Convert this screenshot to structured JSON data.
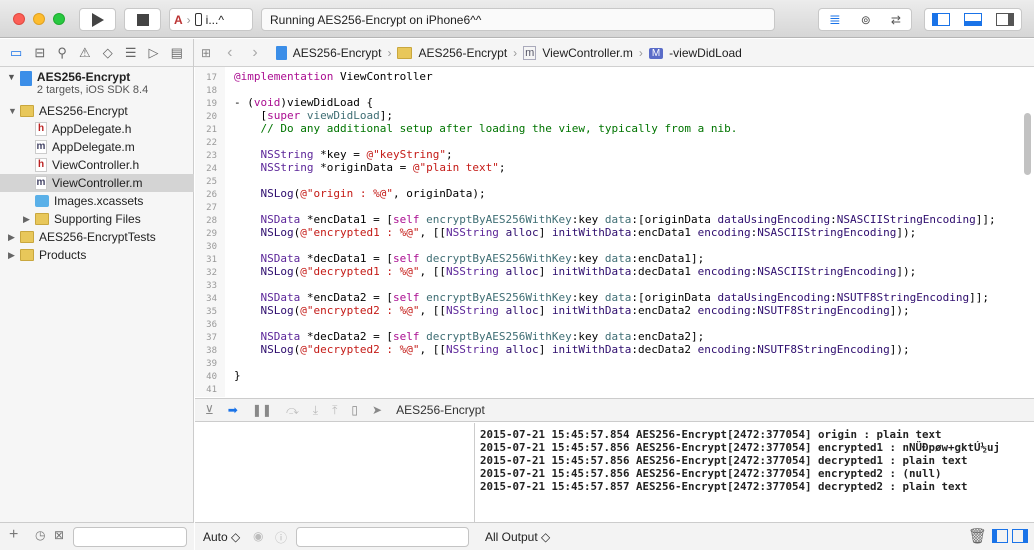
{
  "toolbar": {
    "scheme_device": "i...^",
    "status": "Running AES256-Encrypt on iPhone6^^"
  },
  "navigator_icons": [
    "folder-icon",
    "hierarchy-icon",
    "search-icon",
    "warning-icon",
    "test-diamond-icon",
    "debug-list-icon",
    "breakpoint-icon",
    "report-icon"
  ],
  "jumpbar": [
    "AES256-Encrypt",
    "AES256-Encrypt",
    "ViewController.m",
    "-viewDidLoad"
  ],
  "navigator": {
    "project": {
      "name": "AES256-Encrypt",
      "subtitle": "2 targets, iOS SDK 8.4"
    },
    "items": [
      {
        "label": "AES256-Encrypt",
        "type": "folder",
        "level": 1,
        "disclosure": "open"
      },
      {
        "label": "AppDelegate.h",
        "type": "h",
        "level": 2
      },
      {
        "label": "AppDelegate.m",
        "type": "m",
        "level": 2
      },
      {
        "label": "ViewController.h",
        "type": "h",
        "level": 2
      },
      {
        "label": "ViewController.m",
        "type": "m",
        "level": 2,
        "selected": true
      },
      {
        "label": "Images.xcassets",
        "type": "assets",
        "level": 2
      },
      {
        "label": "Supporting Files",
        "type": "folder",
        "level": 2,
        "disclosure": "closed"
      },
      {
        "label": "AES256-EncryptTests",
        "type": "folder",
        "level": 1,
        "disclosure": "closed"
      },
      {
        "label": "Products",
        "type": "folder",
        "level": 1,
        "disclosure": "closed"
      }
    ]
  },
  "code": [
    {
      "n": "17",
      "seg": [
        [
          "k",
          "@implementation"
        ],
        [
          "p",
          " ViewController"
        ]
      ]
    },
    {
      "n": "18",
      "seg": []
    },
    {
      "n": "19",
      "seg": [
        [
          "p",
          "- ("
        ],
        [
          "k",
          "void"
        ],
        [
          "p",
          ")viewDidLoad {"
        ]
      ]
    },
    {
      "n": "20",
      "seg": [
        [
          "p",
          "    ["
        ],
        [
          "k",
          "super"
        ],
        [
          "p",
          " "
        ],
        [
          "mm",
          "viewDidLoad"
        ],
        [
          "p",
          "];"
        ]
      ]
    },
    {
      "n": "21",
      "seg": [
        [
          "c",
          "    // Do any additional setup after loading the view, typically from a nib."
        ]
      ]
    },
    {
      "n": "22",
      "seg": []
    },
    {
      "n": "23",
      "seg": [
        [
          "t",
          "    NSString"
        ],
        [
          "p",
          " *key = "
        ],
        [
          "s",
          "@\"keyString\""
        ],
        [
          "p",
          ";"
        ]
      ]
    },
    {
      "n": "24",
      "seg": [
        [
          "t",
          "    NSString"
        ],
        [
          "p",
          " *originData = "
        ],
        [
          "s",
          "@\"plain text\""
        ],
        [
          "p",
          ";"
        ]
      ]
    },
    {
      "n": "25",
      "seg": []
    },
    {
      "n": "26",
      "seg": [
        [
          "m",
          "    NSLog"
        ],
        [
          "p",
          "("
        ],
        [
          "s",
          "@\"origin : %@\""
        ],
        [
          "p",
          ", originData);"
        ]
      ]
    },
    {
      "n": "27",
      "seg": []
    },
    {
      "n": "28",
      "seg": [
        [
          "t",
          "    NSData"
        ],
        [
          "p",
          " *encData1 = ["
        ],
        [
          "k",
          "self"
        ],
        [
          "p",
          " "
        ],
        [
          "mm",
          "encryptByAES256WithKey"
        ],
        [
          "p",
          ":key "
        ],
        [
          "mm",
          "data"
        ],
        [
          "p",
          ":[originData "
        ],
        [
          "m",
          "dataUsingEncoding"
        ],
        [
          "p",
          ":"
        ],
        [
          "m",
          "NSASCIIStringEncoding"
        ],
        [
          "p",
          "]];"
        ]
      ]
    },
    {
      "n": "29",
      "seg": [
        [
          "m",
          "    NSLog"
        ],
        [
          "p",
          "("
        ],
        [
          "s",
          "@\"encrypted1 : %@\""
        ],
        [
          "p",
          ", [["
        ],
        [
          "t",
          "NSString"
        ],
        [
          "p",
          " "
        ],
        [
          "m",
          "alloc"
        ],
        [
          "p",
          "] "
        ],
        [
          "m",
          "initWithData"
        ],
        [
          "p",
          ":encData1 "
        ],
        [
          "m",
          "encoding"
        ],
        [
          "p",
          ":"
        ],
        [
          "m",
          "NSASCIIStringEncoding"
        ],
        [
          "p",
          "]);"
        ]
      ]
    },
    {
      "n": "30",
      "seg": []
    },
    {
      "n": "31",
      "seg": [
        [
          "t",
          "    NSData"
        ],
        [
          "p",
          " *decData1 = ["
        ],
        [
          "k",
          "self"
        ],
        [
          "p",
          " "
        ],
        [
          "mm",
          "decryptByAES256WithKey"
        ],
        [
          "p",
          ":key "
        ],
        [
          "mm",
          "data"
        ],
        [
          "p",
          ":encData1];"
        ]
      ]
    },
    {
      "n": "32",
      "seg": [
        [
          "m",
          "    NSLog"
        ],
        [
          "p",
          "("
        ],
        [
          "s",
          "@\"decrypted1 : %@\""
        ],
        [
          "p",
          ", [["
        ],
        [
          "t",
          "NSString"
        ],
        [
          "p",
          " "
        ],
        [
          "m",
          "alloc"
        ],
        [
          "p",
          "] "
        ],
        [
          "m",
          "initWithData"
        ],
        [
          "p",
          ":decData1 "
        ],
        [
          "m",
          "encoding"
        ],
        [
          "p",
          ":"
        ],
        [
          "m",
          "NSASCIIStringEncoding"
        ],
        [
          "p",
          "]);"
        ]
      ]
    },
    {
      "n": "33",
      "seg": []
    },
    {
      "n": "34",
      "seg": [
        [
          "t",
          "    NSData"
        ],
        [
          "p",
          " *encData2 = ["
        ],
        [
          "k",
          "self"
        ],
        [
          "p",
          " "
        ],
        [
          "mm",
          "encryptByAES256WithKey"
        ],
        [
          "p",
          ":key "
        ],
        [
          "mm",
          "data"
        ],
        [
          "p",
          ":[originData "
        ],
        [
          "m",
          "dataUsingEncoding"
        ],
        [
          "p",
          ":"
        ],
        [
          "m",
          "NSUTF8StringEncoding"
        ],
        [
          "p",
          "]];"
        ]
      ]
    },
    {
      "n": "35",
      "seg": [
        [
          "m",
          "    NSLog"
        ],
        [
          "p",
          "("
        ],
        [
          "s",
          "@\"encrypted2 : %@\""
        ],
        [
          "p",
          ", [["
        ],
        [
          "t",
          "NSString"
        ],
        [
          "p",
          " "
        ],
        [
          "m",
          "alloc"
        ],
        [
          "p",
          "] "
        ],
        [
          "m",
          "initWithData"
        ],
        [
          "p",
          ":encData2 "
        ],
        [
          "m",
          "encoding"
        ],
        [
          "p",
          ":"
        ],
        [
          "m",
          "NSUTF8StringEncoding"
        ],
        [
          "p",
          "]);"
        ]
      ]
    },
    {
      "n": "36",
      "seg": []
    },
    {
      "n": "37",
      "seg": [
        [
          "t",
          "    NSData"
        ],
        [
          "p",
          " *decData2 = ["
        ],
        [
          "k",
          "self"
        ],
        [
          "p",
          " "
        ],
        [
          "mm",
          "decryptByAES256WithKey"
        ],
        [
          "p",
          ":key "
        ],
        [
          "mm",
          "data"
        ],
        [
          "p",
          ":encData2];"
        ]
      ]
    },
    {
      "n": "38",
      "seg": [
        [
          "m",
          "    NSLog"
        ],
        [
          "p",
          "("
        ],
        [
          "s",
          "@\"decrypted2 : %@\""
        ],
        [
          "p",
          ", [["
        ],
        [
          "t",
          "NSString"
        ],
        [
          "p",
          " "
        ],
        [
          "m",
          "alloc"
        ],
        [
          "p",
          "] "
        ],
        [
          "m",
          "initWithData"
        ],
        [
          "p",
          ":decData2 "
        ],
        [
          "m",
          "encoding"
        ],
        [
          "p",
          ":"
        ],
        [
          "m",
          "NSUTF8StringEncoding"
        ],
        [
          "p",
          "]);"
        ]
      ]
    },
    {
      "n": "39",
      "seg": []
    },
    {
      "n": "40",
      "seg": [
        [
          "p",
          "}"
        ]
      ]
    },
    {
      "n": "41",
      "seg": []
    }
  ],
  "debugbar": {
    "target": "AES256-Encrypt"
  },
  "console": [
    "2015-07-21 15:45:57.854 AES256-Encrypt[2472:377054] origin : plain text",
    "2015-07-21 15:45:57.856 AES256-Encrypt[2472:377054] encrypted1 : nNÜÐpøw+gktÚ½uj",
    "2015-07-21 15:45:57.856 AES256-Encrypt[2472:377054] decrypted1 : plain text",
    "2015-07-21 15:45:57.856 AES256-Encrypt[2472:377054] encrypted2 : (null)",
    "2015-07-21 15:45:57.857 AES256-Encrypt[2472:377054] decrypted2 : plain text"
  ],
  "bottom": {
    "vars_scope": "Auto ◇",
    "output_scope": "All Output ◇"
  },
  "colors": {
    "accent": "#1a73e8",
    "selection": "#d4d4d4",
    "keyword": "#aa0d91",
    "string": "#c41a16",
    "comment": "#007400"
  }
}
